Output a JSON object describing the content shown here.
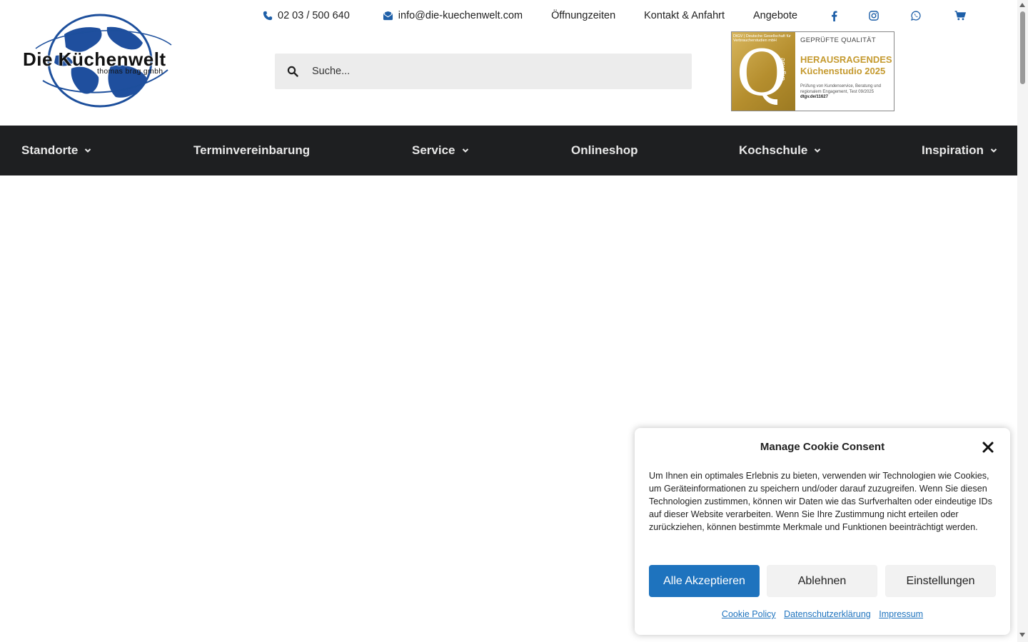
{
  "logo": {
    "title": "Die Küchenwelt",
    "subtitle": "thomas brag gmbh"
  },
  "topbar": {
    "phone": "02 03 / 500 640",
    "email": "info@die-kuechenwelt.com",
    "opening_hours": "Öffnungzeiten",
    "contact": "Kontakt & Anfahrt",
    "offers": "Angebote",
    "icons": [
      "phone-icon",
      "envelope-icon",
      "facebook-icon",
      "instagram-icon",
      "whatsapp-icon",
      "cart-icon"
    ],
    "icon_color": "#1e5fa8"
  },
  "search": {
    "placeholder": "Suche..."
  },
  "badge": {
    "org": "DtGV | Deutsche Gesellschaft für Verbraucherstudien mbH",
    "site": "dtgv.de",
    "heading": "GEPRÜFTE QUALITÄT",
    "line1": "HERAUSRAGENDES",
    "line2": "Küchenstudio 2025",
    "detail": "Prüfung von Kundenservice, Beratung und regionalem Engagement, Test 09/2025",
    "ref": "dtgv.de/11627"
  },
  "nav": {
    "background": "#1e1f21",
    "items": [
      {
        "label": "Standorte",
        "dropdown": true
      },
      {
        "label": "Terminvereinbarung",
        "dropdown": false
      },
      {
        "label": "Service",
        "dropdown": true
      },
      {
        "label": "Onlineshop",
        "dropdown": false
      },
      {
        "label": "Kochschule",
        "dropdown": true
      },
      {
        "label": "Inspiration",
        "dropdown": true
      }
    ]
  },
  "cookie": {
    "title": "Manage Cookie Consent",
    "text": "Um Ihnen ein optimales Erlebnis zu bieten, verwenden wir Technologien wie Cookies, um Geräteinformationen zu speichern und/oder darauf zuzugreifen. Wenn Sie diesen Technologien zustimmen, können wir Daten wie das Surfverhalten oder eindeutige IDs auf dieser Website verarbeiten. Wenn Sie Ihre Zustimmung nicht erteilen oder zurückziehen, können bestimmte Merkmale und Funktionen beeinträchtigt werden.",
    "accept": "Alle Akzeptieren",
    "deny": "Ablehnen",
    "settings": "Einstellungen",
    "links": {
      "cookie_policy": "Cookie Policy",
      "privacy": "Datenschutzerklärung",
      "imprint": "Impressum"
    },
    "accent": "#1e73be"
  }
}
